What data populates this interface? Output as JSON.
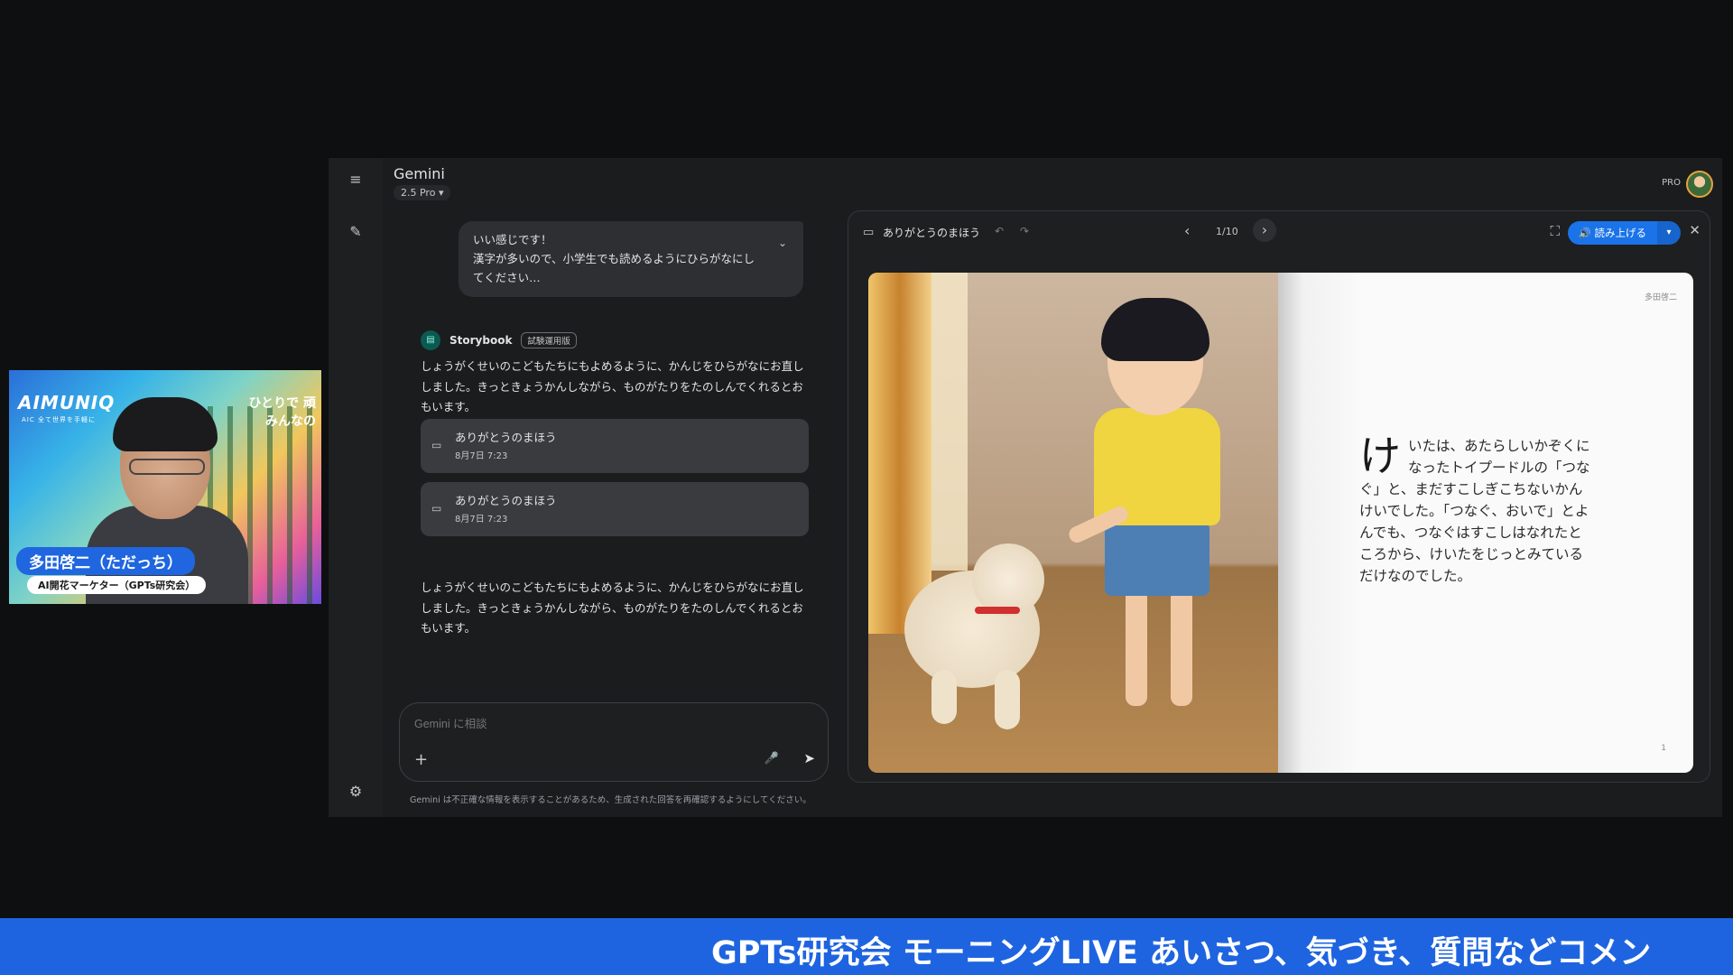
{
  "webcam": {
    "brand": "AIMUNIQ",
    "brand_sub": "AIC 全て世界を手軽に",
    "slogan_line1": "ひとりで 頑",
    "slogan_line2": "みんなの",
    "name": "多田啓二（ただっち）",
    "role": "AI開花マーケター（GPTs研究会）"
  },
  "rail": {
    "menu_icon": "≡",
    "new_chat_icon": "✎",
    "settings_icon": "⚙"
  },
  "header": {
    "title": "Gemini",
    "model": "2.5 Pro ▾",
    "plan": "PRO"
  },
  "chat": {
    "user_message_line1": "いい感じです！",
    "user_message_line2": "漢字が多いので、小学生でも読めるようにひらがなにし",
    "user_message_line3": "てください…",
    "agent_name": "Storybook",
    "agent_badge": "試験運用版",
    "response_text": "しょうがくせいのこどもたちにもよめるように、かんじをひらがなにお直ししました。きっときょうかんしながら、ものがたりをたのしんでくれるとおもいます。",
    "cards": [
      {
        "title": "ありがとうのまほう",
        "date": "8月7日 7:23"
      },
      {
        "title": "ありがとうのまほう",
        "date": "8月7日 7:23"
      }
    ],
    "response_text_2": "しょうがくせいのこどもたちにもよめるように、かんじをひらがなにお直ししました。きっときょうかんしながら、ものがたりをたのしんでくれるとおもいます。"
  },
  "composer": {
    "placeholder": "Gemini に相談",
    "disclaimer": "Gemini は不正確な情報を表示することがあるため、生成された回答を再確認するようにしてください。"
  },
  "viewer": {
    "title": "ありがとうのまほう",
    "page_indicator": "1/10",
    "read_aloud": "🔊 読み上げる",
    "author": "多田啓二",
    "dropcap": "け",
    "story_text": "いたは、あたらしいかぞくになったトイプードルの「つなぐ」と、まだすこしぎこちないかんけいでした。「つなぐ、おいで」とよんでも、つなぐはすこしはなれたところから、けいたをじっとみているだけなのでした。",
    "page_number": "1"
  },
  "ticker": {
    "text": "GPTs研究会 モーニングLIVE あいさつ、気づき、質問などコメン"
  }
}
